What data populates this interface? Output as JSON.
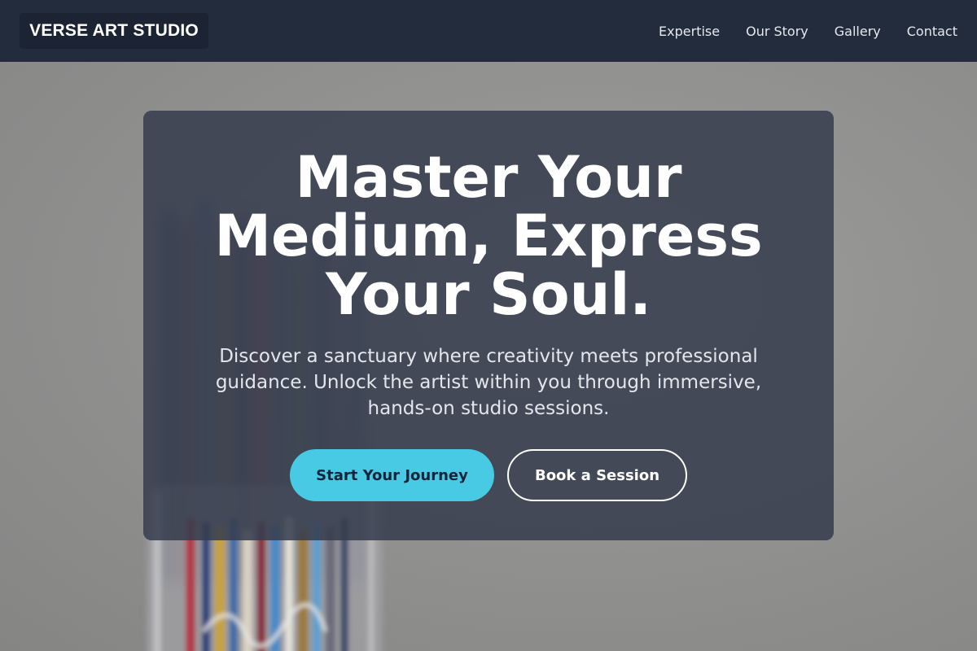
{
  "header": {
    "logo_text": "VERSE ART STUDIO",
    "nav": [
      {
        "label": "Expertise"
      },
      {
        "label": "Our Story"
      },
      {
        "label": "Gallery"
      },
      {
        "label": "Contact"
      }
    ]
  },
  "hero": {
    "background_image": "blurred jar of paint brushes",
    "title": "Master Your Medium, Express Your Soul.",
    "subtitle": "Discover a sanctuary where creativity meets professional guidance. Unlock the artist within you through immersive, hands-on studio sessions.",
    "primary_button": "Start Your Journey",
    "secondary_button": "Book a Session"
  },
  "colors": {
    "header_bg": "#232c3c",
    "accent": "#48cae4",
    "card_bg": "#353d4d"
  }
}
